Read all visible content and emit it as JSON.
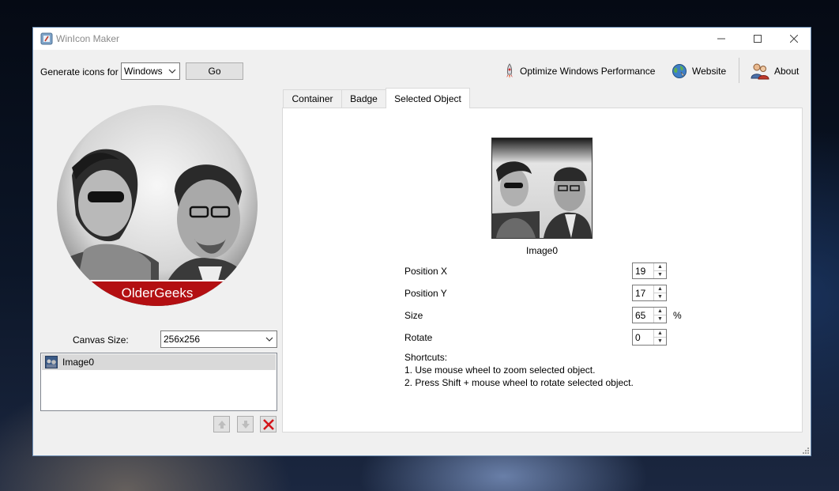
{
  "window": {
    "title": "WinIcon Maker"
  },
  "toolbar": {
    "generate_label": "Generate icons for",
    "platform_value": "Windows",
    "go_label": "Go",
    "optimize_label": "Optimize Windows Performance",
    "website_label": "Website",
    "about_label": "About"
  },
  "preview": {
    "badge_text": "OlderGeeks"
  },
  "canvas": {
    "label": "Canvas Size:",
    "value": "256x256"
  },
  "objects": {
    "items": [
      {
        "label": "Image0"
      }
    ]
  },
  "tabs": [
    {
      "label": "Container"
    },
    {
      "label": "Badge"
    },
    {
      "label": "Selected Object"
    }
  ],
  "selected_object": {
    "name": "Image0",
    "position_x_label": "Position X",
    "position_x": "19",
    "position_y_label": "Position Y",
    "position_y": "17",
    "size_label": "Size",
    "size": "65",
    "size_unit": "%",
    "rotate_label": "Rotate",
    "rotate": "0",
    "shortcuts_title": "Shortcuts:",
    "shortcut_1": "1. Use mouse wheel to zoom selected object.",
    "shortcut_2": "2. Press Shift + mouse wheel to rotate selected object."
  },
  "colors": {
    "badge_red": "#b30f12",
    "accent_border": "#6d8fb6"
  }
}
